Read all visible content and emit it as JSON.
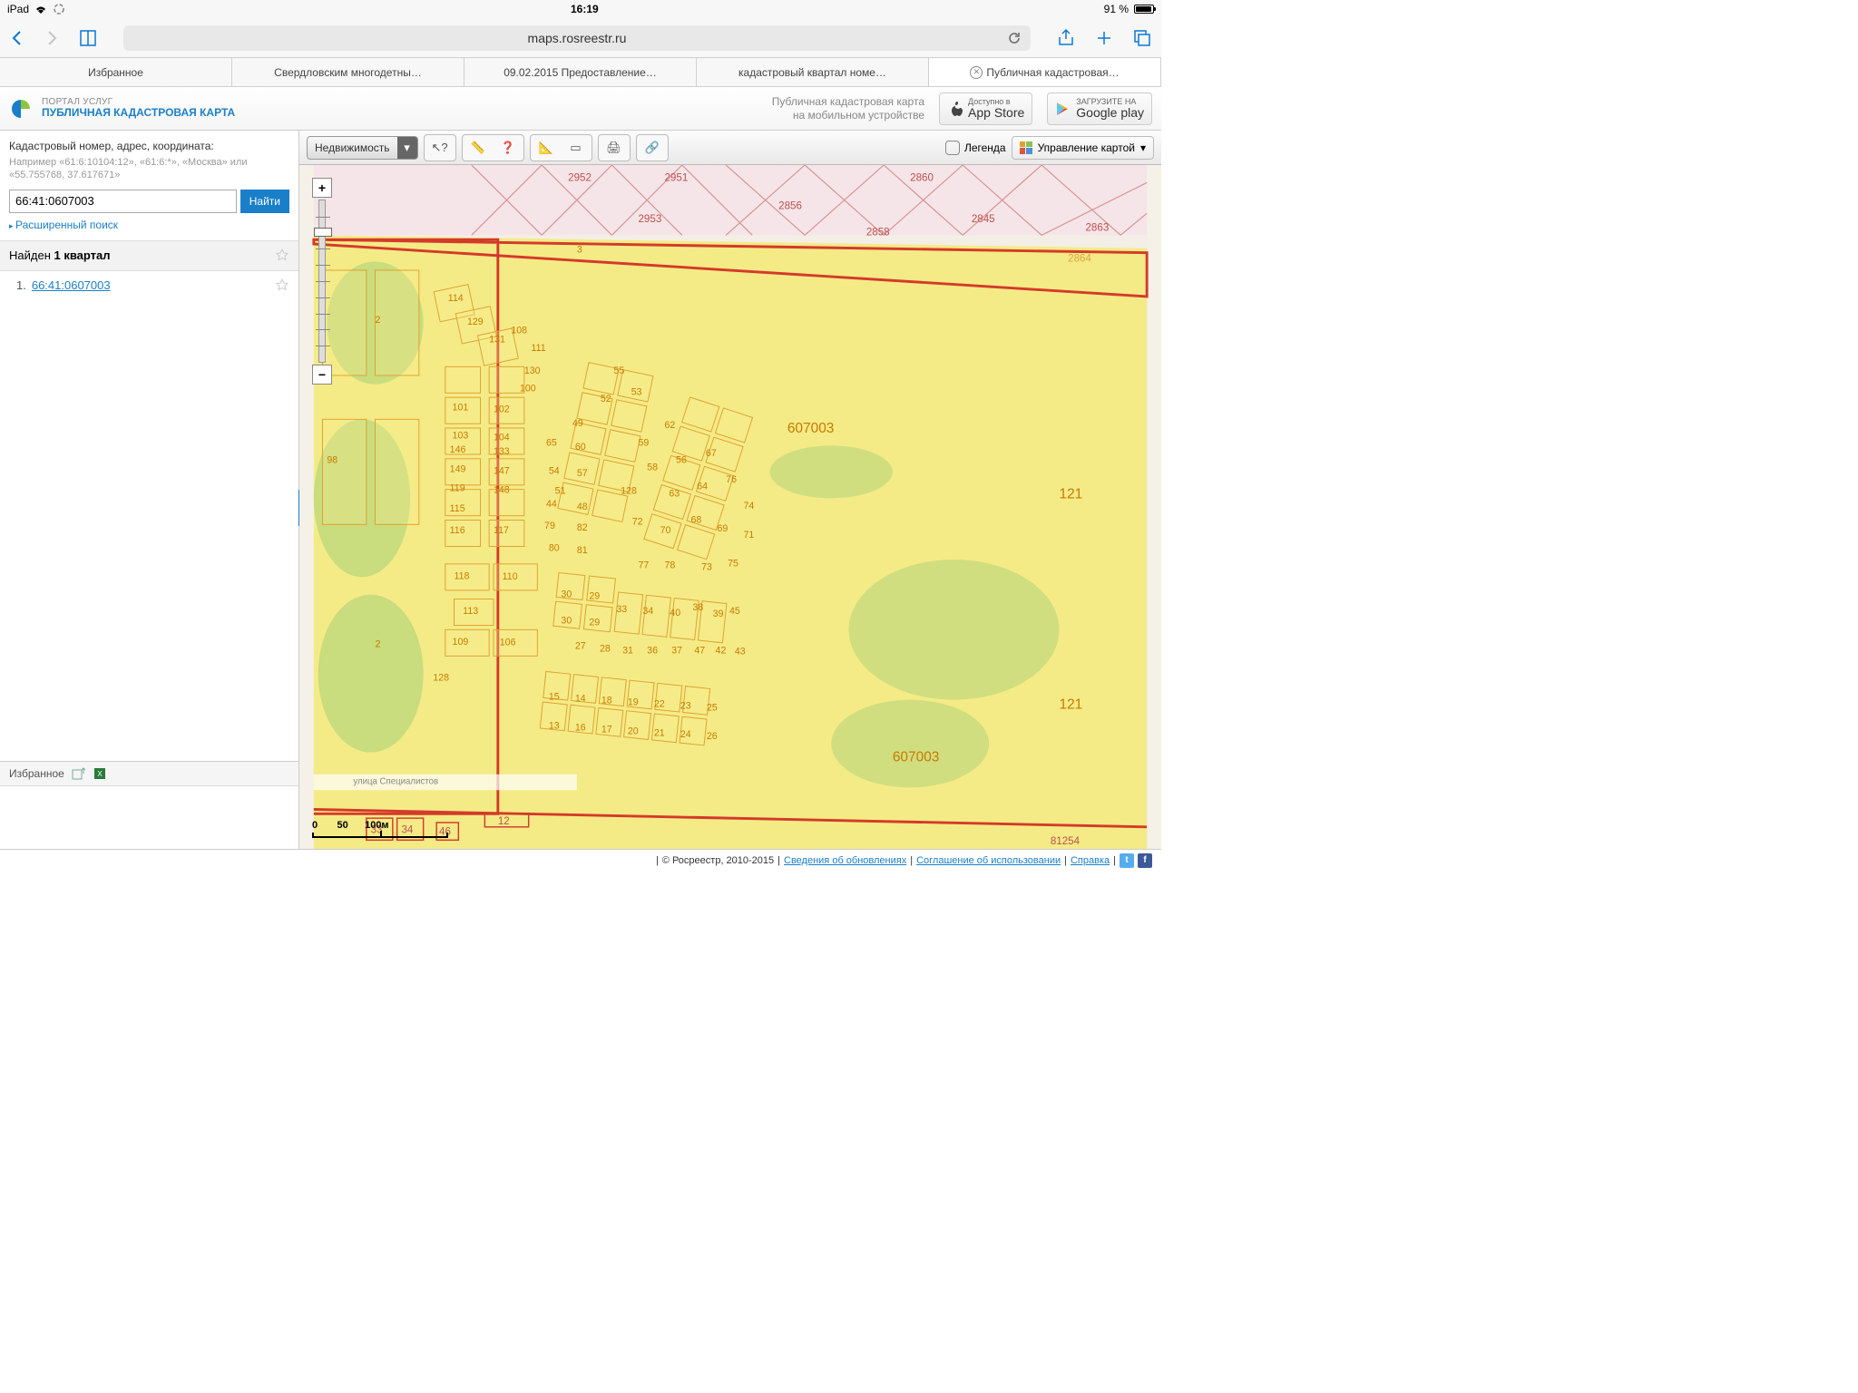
{
  "status": {
    "device": "iPad",
    "time": "16:19",
    "battery": "91 %"
  },
  "safari": {
    "address": "maps.rosreestr.ru"
  },
  "tabs": [
    {
      "label": "Избранное"
    },
    {
      "label": "Свердловским многодетны…"
    },
    {
      "label": "09.02.2015 Предоставление…"
    },
    {
      "label": "кадастровый квартал номе…"
    },
    {
      "label": "Публичная кадастровая…",
      "active": true
    }
  ],
  "header": {
    "line1": "ПОРТАЛ УСЛУГ",
    "line2": "ПУБЛИЧНАЯ КАДАСТРОВАЯ КАРТА",
    "promo1": "Публичная кадастровая карта",
    "promo2": "на мобильном устройстве",
    "appstore": {
      "small": "Доступно в",
      "big": "App Store"
    },
    "gplay": {
      "small": "ЗАГРУЗИТЕ НА",
      "big": "Google play"
    }
  },
  "search": {
    "label": "Кадастровый номер, адрес, координата:",
    "hint": "Например «61:6:10104:12», «61:6:*», «Москва» или «55.755768, 37.617671»",
    "value": "66:41:0607003",
    "button": "Найти",
    "advanced": "Расширенный поиск"
  },
  "results": {
    "header_pre": "Найден ",
    "header_bold": "1 квартал",
    "items": [
      {
        "n": "1.",
        "id": "66:41:0607003"
      }
    ]
  },
  "favorites": {
    "label": "Избранное"
  },
  "toolbar": {
    "layer": "Недвижимость",
    "legend": "Легенда",
    "map_control": "Управление картой"
  },
  "map": {
    "block_label": "607003",
    "street": "улица Специалистов",
    "scale_labels": "0       50      100м",
    "labels": {
      "2952": "2952",
      "2951": "2951",
      "2953": "2953",
      "2860": "2860",
      "2856": "2856",
      "2858": "2858",
      "2845": "2845",
      "2863": "2863",
      "2864": "2864",
      "p98": "98",
      "p114": "114",
      "p129": "129",
      "p131": "131",
      "p108": "108",
      "p111": "111",
      "p130": "130",
      "p100": "100",
      "p101": "101",
      "p102": "102",
      "p103": "103",
      "p104": "104",
      "p146": "146",
      "p133": "133",
      "p149": "149",
      "p147": "147",
      "p119": "119",
      "p148": "148",
      "p115": "115",
      "p116": "116",
      "p117": "117",
      "p118": "118",
      "p110": "110",
      "p113": "113",
      "p109": "109",
      "p106": "106",
      "p55": "55",
      "p52": "52",
      "p53": "53",
      "p49": "49",
      "p65": "65",
      "p60": "60",
      "p59": "59",
      "p62": "62",
      "p54": "54",
      "p57": "57",
      "p51": "51",
      "p58": "58",
      "p56": "56",
      "p67": "67",
      "p44": "44",
      "p48": "48",
      "p128": "128",
      "p63": "63",
      "p64": "64",
      "p76": "76",
      "p79": "79",
      "p82": "82",
      "p72": "72",
      "p70": "70",
      "p68": "68",
      "p69": "69",
      "p74": "74",
      "p80": "80",
      "p81": "81",
      "p77": "77",
      "p78": "78",
      "p73": "73",
      "p75": "75",
      "p71": "71",
      "p30": "30",
      "p29": "29",
      "p33": "33",
      "p34_2": "34",
      "p40": "40",
      "p38": "38",
      "p39": "39",
      "p27": "27",
      "p28": "28",
      "p31": "31",
      "p36": "36",
      "p37": "37",
      "p47": "47",
      "p42": "42",
      "p43": "43",
      "p45": "45",
      "p15": "15",
      "p14": "14",
      "p18": "18",
      "p19": "19",
      "p22": "22",
      "p23": "23",
      "p25": "25",
      "p13": "13",
      "p16": "16",
      "p17": "17",
      "p20": "20",
      "p21": "21",
      "p24": "24",
      "p26": "26",
      "p2": "2",
      "p3": "3",
      "p12": "12",
      "p33b": "33",
      "p34b": "34",
      "p46": "46",
      "p121a": "121",
      "p121b": "121",
      "lower128": "128",
      "b81254": "81254"
    }
  },
  "footer": {
    "copyright": "© Росреестр, 2010-2015",
    "links": [
      "Сведения об обновлениях",
      "Соглашение об использовании",
      "Справка"
    ]
  }
}
